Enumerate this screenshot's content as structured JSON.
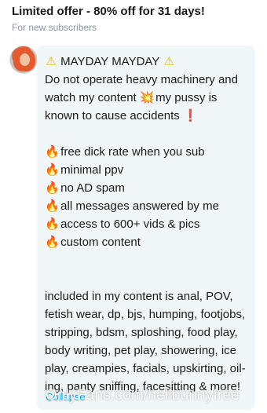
{
  "offer": {
    "title": "Limited offer - 80% off for 31 days!",
    "subtitle": "For new subscribers"
  },
  "post": {
    "avatar_icon": "avatar-photo",
    "lines": {
      "l1": "MAYDAY MAYDAY",
      "l2": "Do not operate heavy machinery and",
      "l3a": "watch my content",
      "l3b": "my pussy is",
      "l4": "known to cause accidents",
      "b1": "free dick rate when you sub",
      "b2": "minimal ppv",
      "b3": "no AD spam",
      "b4": "all messages answered by me",
      "b5": "access to 600+ vids & pics",
      "b6": "custom content",
      "p1": "included in my content is anal, POV,",
      "p2": "fetish wear, dp, bjs, humping, footjobs,",
      "p3": "stripping, bdsm, sploshing, food play,",
      "p4": "body writing, pet play, showering, ice",
      "p5": "play, creampies, facials, upskirting, oil-",
      "p6": "ing, panty sniffing, facesitting & more!"
    },
    "collapse_label": "Collapse"
  },
  "emoji": {
    "warning": "⚠",
    "fire": "🔥",
    "collision": "💥",
    "exclamation": "❗"
  },
  "watermark": "OnlyFans.com/hellbunnyfree",
  "colors": {
    "bubble_bg": "#f1f6f9",
    "link": "#00aff0",
    "muted": "#8a96a3"
  }
}
